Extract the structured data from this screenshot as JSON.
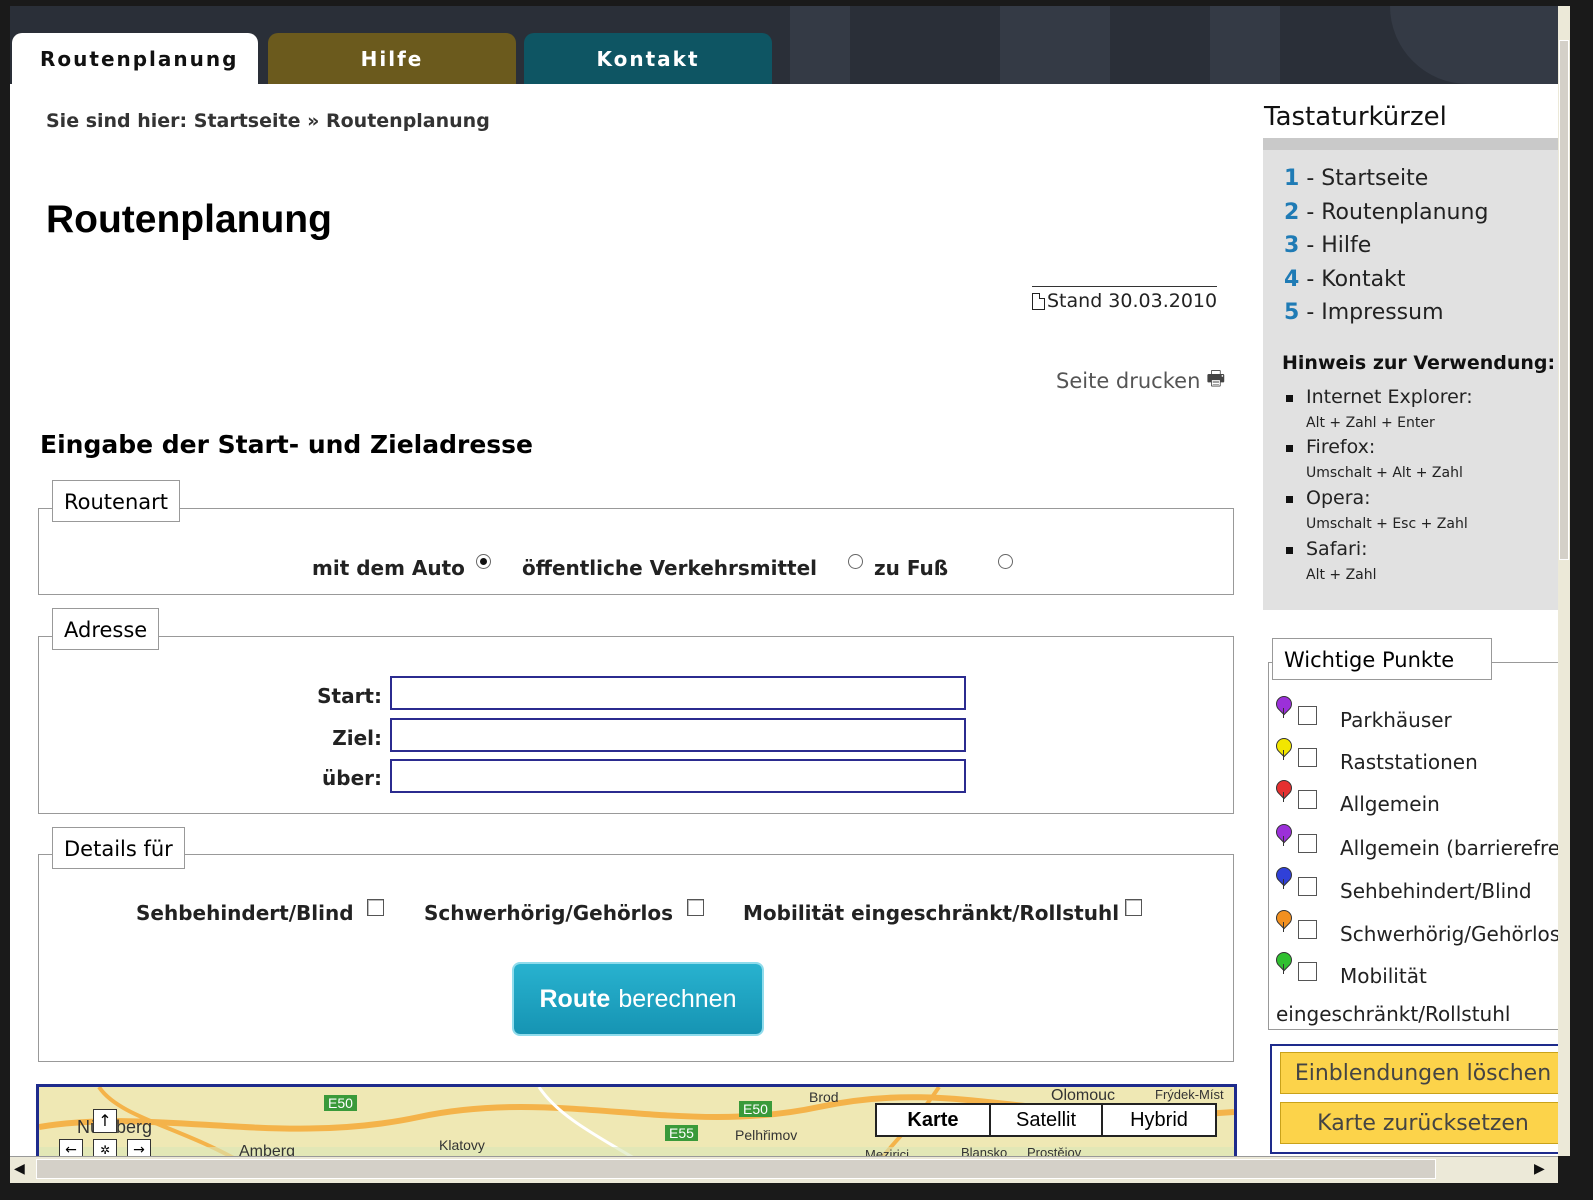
{
  "tabs": [
    {
      "label": "Routenplanung"
    },
    {
      "label": "Hilfe"
    },
    {
      "label": "Kontakt"
    }
  ],
  "breadcrumb": "Sie sind hier: Startseite » Routenplanung",
  "page_title": "Routenplanung",
  "stand": "Stand 30.03.2010",
  "print_label": "Seite drucken",
  "section_title": "Eingabe der Start- und Zieladresse",
  "routenart": {
    "legend": "Routenart",
    "options": [
      {
        "label": "mit dem Auto",
        "checked": true
      },
      {
        "label": "öffentliche Verkehrsmittel",
        "checked": false
      },
      {
        "label": "zu Fuß",
        "checked": false
      }
    ]
  },
  "adresse": {
    "legend": "Adresse",
    "fields": [
      {
        "label": "Start:",
        "value": ""
      },
      {
        "label": "Ziel:",
        "value": ""
      },
      {
        "label": "über:",
        "value": ""
      }
    ]
  },
  "details": {
    "legend": "Details für",
    "options": [
      {
        "label": "Sehbehindert/Blind"
      },
      {
        "label": "Schwerhörig/Gehörlos"
      },
      {
        "label": "Mobilität eingeschränkt/Rollstuhl"
      }
    ]
  },
  "route_button": {
    "bold": "Route",
    "rest": "berechnen"
  },
  "map": {
    "buttons": [
      "Karte",
      "Satellit",
      "Hybrid"
    ],
    "labels": [
      "E50",
      "E50",
      "E55",
      "Amberg",
      "Klatovy",
      "Brod",
      "Pelhřimov",
      "Olomouc",
      "Blansko",
      "Prostějov",
      "Mezirici",
      "Frýdek-Míst"
    ],
    "city_partial": "Nürnberg"
  },
  "sidebar": {
    "title": "Tastaturkürzel",
    "shortcuts": [
      {
        "key": "1",
        "label": "- Startseite"
      },
      {
        "key": "2",
        "label": "- Routenplanung"
      },
      {
        "key": "3",
        "label": "- Hilfe"
      },
      {
        "key": "4",
        "label": "- Kontakt"
      },
      {
        "key": "5",
        "label": "- Impressum"
      }
    ],
    "hint_title": "Hinweis zur Verwendung:",
    "hints": [
      {
        "browser": "Internet Explorer:",
        "keys": "Alt + Zahl + Enter"
      },
      {
        "browser": "Firefox:",
        "keys": "Umschalt + Alt + Zahl"
      },
      {
        "browser": "Opera:",
        "keys": "Umschalt + Esc + Zahl"
      },
      {
        "browser": "Safari:",
        "keys": "Alt + Zahl"
      }
    ]
  },
  "poi": {
    "legend": "Wichtige Punkte",
    "items": [
      {
        "label": "Parkhäuser",
        "color": "#9b30d9"
      },
      {
        "label": "Raststationen",
        "color": "#f2e600"
      },
      {
        "label": "Allgemein",
        "color": "#e53030"
      },
      {
        "label": "Allgemein (barrierefrei)",
        "color": "#9b30d9"
      },
      {
        "label": "Sehbehindert/Blind",
        "color": "#3040d8"
      },
      {
        "label": "Schwerhörig/Gehörlos",
        "color": "#f29020"
      },
      {
        "label": "Mobilität",
        "color": "#30c030"
      }
    ],
    "wrap": "eingeschränkt/Rollstuhl"
  },
  "map_actions": {
    "clear": "Einblendungen löschen",
    "reset": "Karte zurücksetzen"
  }
}
